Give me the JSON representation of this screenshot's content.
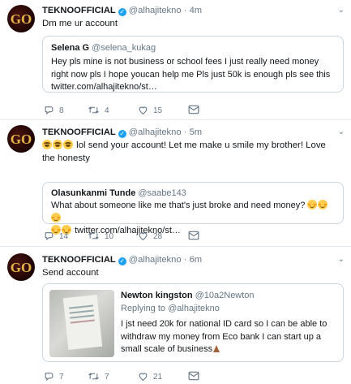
{
  "colors": {
    "accent": "#1da1f2",
    "muted": "#657786",
    "text": "#14171a",
    "border": "#e6ecf0"
  },
  "tweets": [
    {
      "author": "TEKNOOFFICIAL",
      "handle": "@alhajitekno",
      "dot": "·",
      "time": "4m",
      "text": "Dm me ur account",
      "quote": {
        "name": "Selena G",
        "handle": "@selena_kukag",
        "text": "Hey pls mine is not business or school fees I just really need money right now pls I hope youcan help me Pls just 50k is enough pls see this twitter.com/alhajitekno/st…"
      },
      "replies": "8",
      "retweets": "4",
      "likes": "15"
    },
    {
      "author": "TEKNOOFFICIAL",
      "handle": "@alhajitekno",
      "dot": "·",
      "time": "5m",
      "text": "lol send your account! Let me make u smile my brother! Love the honesty",
      "quote": {
        "name": "Olasunkanmi Tunde",
        "handle": "@saabe143",
        "text_a": "What about someone like me that's just broke and need money?",
        "text_b": "twitter.com/alhajitekno/st…"
      },
      "replies": "14",
      "retweets": "10",
      "likes": "28"
    },
    {
      "author": "TEKNOOFFICIAL",
      "handle": "@alhajitekno",
      "dot": "·",
      "time": "6m",
      "text": "Send account",
      "quote": {
        "name": "Newton kingston",
        "handle": "@10a2Newton",
        "replying_prefix": "Replying to",
        "replying_to": "@alhajitekno",
        "text": "I jst need 20k for national ID card so I can be able to withdraw my money from Eco bank I can start up a small scale of business"
      },
      "replies": "7",
      "retweets": "7",
      "likes": "21"
    }
  ]
}
